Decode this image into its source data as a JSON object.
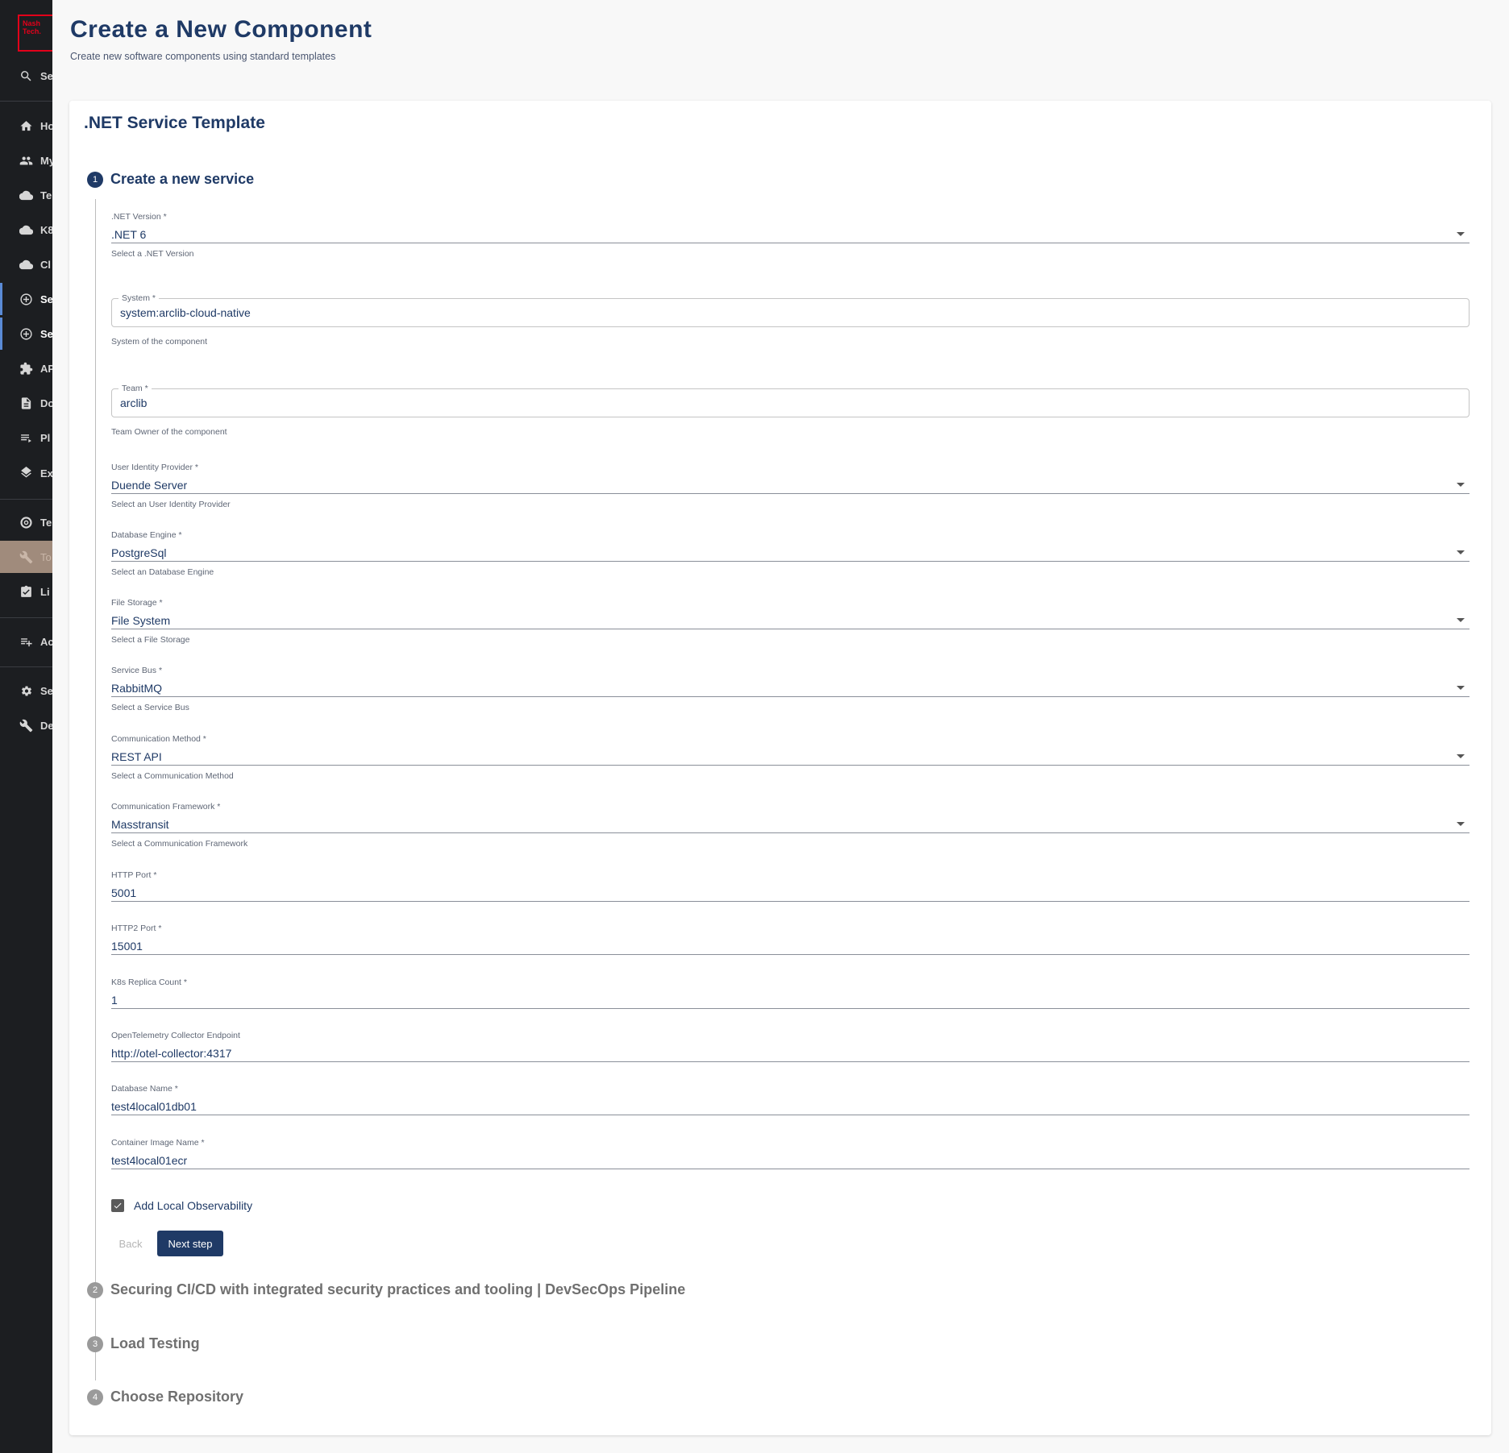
{
  "sidebar": {
    "logo": "Nash\nTech.",
    "items": [
      {
        "label": "Se",
        "icon": "search-icon"
      },
      {
        "label": "Ho",
        "icon": "home-icon"
      },
      {
        "label": "My",
        "icon": "group-icon"
      },
      {
        "label": "Te",
        "icon": "cloud-icon"
      },
      {
        "label": "K8",
        "icon": "cloud-icon"
      },
      {
        "label": "Cl",
        "icon": "cloud-icon"
      },
      {
        "label": "Se",
        "icon": "add-circle-icon"
      },
      {
        "label": "Se",
        "icon": "add-circle-icon"
      },
      {
        "label": "AP",
        "icon": "extension-icon"
      },
      {
        "label": "Do",
        "icon": "document-icon"
      },
      {
        "label": "Pl",
        "icon": "list-icon"
      },
      {
        "label": "Ex",
        "icon": "layers-icon"
      },
      {
        "label": "Te",
        "icon": "radar-icon"
      },
      {
        "label": "To",
        "icon": "wrench-icon"
      },
      {
        "label": "Li",
        "icon": "checklist-icon"
      },
      {
        "label": "Ac",
        "icon": "playlist-add-icon"
      },
      {
        "label": "Se",
        "icon": "gear-icon"
      },
      {
        "label": "De",
        "icon": "wrench-icon"
      }
    ]
  },
  "header": {
    "title": "Create a New Component",
    "subtitle": "Create new software components using standard templates"
  },
  "card": {
    "title": ".NET Service Template"
  },
  "steps": [
    {
      "num": "1",
      "label": "Create a new service"
    },
    {
      "num": "2",
      "label": "Securing CI/CD with integrated security practices and tooling | DevSecOps Pipeline"
    },
    {
      "num": "3",
      "label": "Load Testing"
    },
    {
      "num": "4",
      "label": "Choose Repository"
    }
  ],
  "form": {
    "net_version": {
      "label": ".NET Version *",
      "value": ".NET 6",
      "helper": "Select a .NET Version"
    },
    "system": {
      "label": "System *",
      "value": "system:arclib-cloud-native",
      "helper": "System of the component"
    },
    "team": {
      "label": "Team *",
      "value": "arclib",
      "helper": "Team Owner of the component"
    },
    "identity": {
      "label": "User Identity Provider *",
      "value": "Duende Server",
      "helper": "Select an User Identity Provider"
    },
    "database": {
      "label": "Database Engine *",
      "value": "PostgreSql",
      "helper": "Select an Database Engine"
    },
    "storage": {
      "label": "File Storage *",
      "value": "File System",
      "helper": "Select a File Storage"
    },
    "bus": {
      "label": "Service Bus *",
      "value": "RabbitMQ",
      "helper": "Select a Service Bus"
    },
    "comm_method": {
      "label": "Communication Method *",
      "value": "REST API",
      "helper": "Select a Communication Method"
    },
    "comm_framework": {
      "label": "Communication Framework *",
      "value": "Masstransit",
      "helper": "Select a Communication Framework"
    },
    "http_port": {
      "label": "HTTP Port *",
      "value": "5001"
    },
    "http2_port": {
      "label": "HTTP2 Port *",
      "value": "15001"
    },
    "replica": {
      "label": "K8s Replica Count *",
      "value": "1"
    },
    "otel": {
      "label": "OpenTelemetry Collector Endpoint",
      "value": "http://otel-collector:4317"
    },
    "db_name": {
      "label": "Database Name *",
      "value": "test4local01db01"
    },
    "image": {
      "label": "Container Image Name *",
      "value": "test4local01ecr"
    },
    "observability": {
      "label": "Add Local Observability",
      "checked": true
    }
  },
  "buttons": {
    "back": "Back",
    "next": "Next step"
  }
}
